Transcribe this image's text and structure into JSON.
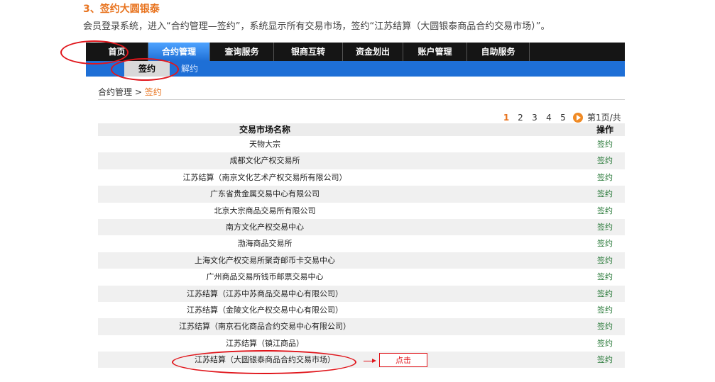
{
  "guide": {
    "step_title": "3、签约大圆银泰",
    "step_desc": "会员登录系统，进入“合约管理—签约”，系统显示所有交易市场，签约“江苏结算（大圆银泰商品合约交易市场）”。",
    "click_label": "点击"
  },
  "nav": {
    "items": [
      "首页",
      "合约管理",
      "查询服务",
      "银商互转",
      "资金划出",
      "账户管理",
      "自助服务"
    ],
    "active_index": 1
  },
  "subnav": {
    "active": "签约",
    "other": "解约"
  },
  "breadcrumb": {
    "parent": "合约管理",
    "separator": ">",
    "current": "签约"
  },
  "pager": {
    "pages": [
      "1",
      "2",
      "3",
      "4",
      "5"
    ],
    "current": "1",
    "info": "第1页/共"
  },
  "table": {
    "headers": {
      "name": "交易市场名称",
      "op": "操作"
    },
    "action_label": "签约",
    "rows": [
      "天物大宗",
      "成都文化产权交易所",
      "江苏结算（南京文化艺术产权交易所有限公司）",
      "广东省贵金属交易中心有限公司",
      "北京大宗商品交易所有限公司",
      "南方文化产权交易中心",
      "渤海商品交易所",
      "上海文化产权交易所聚奇邮币卡交易中心",
      "广州商品交易所钱币邮票交易中心",
      "江苏结算（江苏中苏商品交易中心有限公司）",
      "江苏结算（金陵文化产权交易中心有限公司）",
      "江苏结算（南京石化商品合约交易中心有限公司）",
      "江苏结算（镇江商品）",
      "江苏结算（大圆银泰商品合约交易市场）"
    ]
  },
  "colors": {
    "accent": "#e8731e",
    "nav_active": "#1e6fd6",
    "highlight": "#e0161c",
    "link": "#2a7a3a"
  }
}
